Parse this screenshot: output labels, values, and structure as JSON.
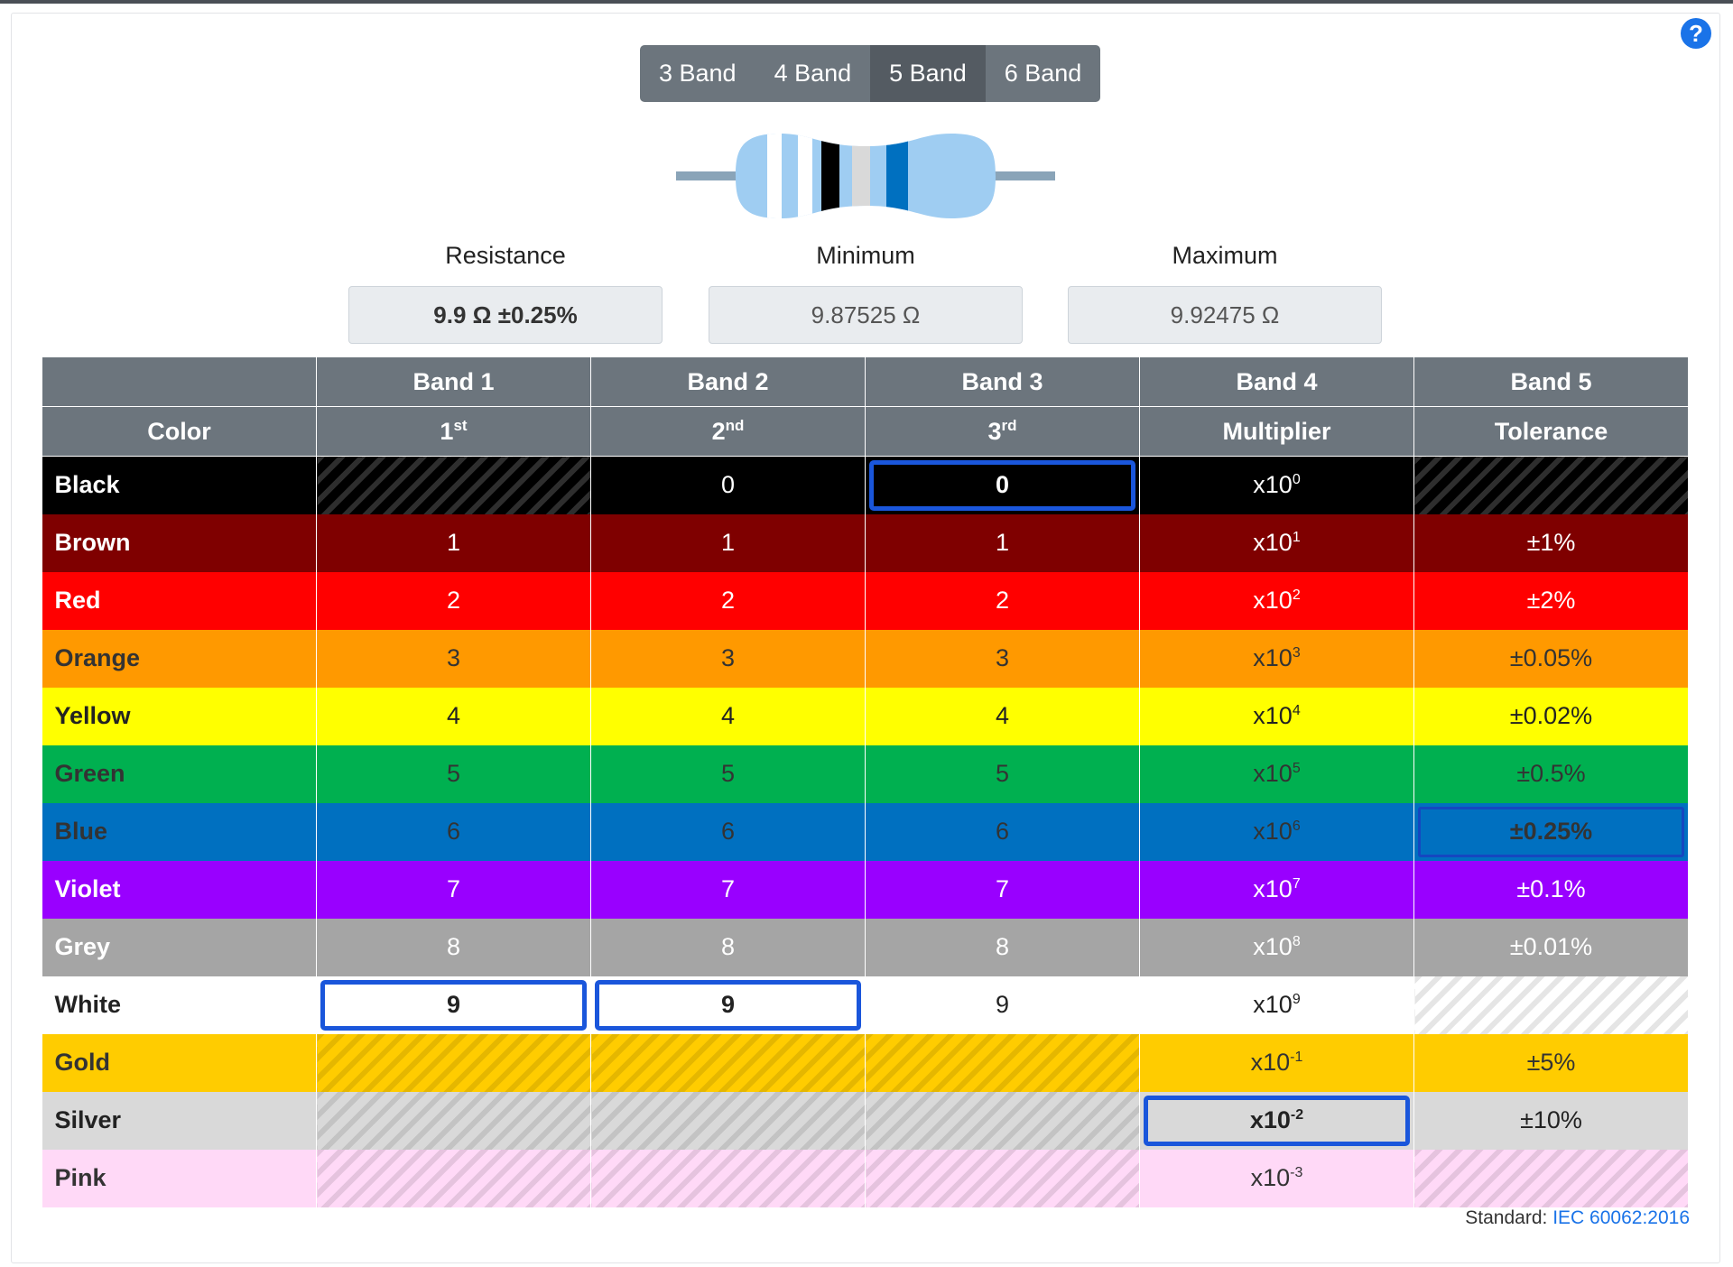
{
  "band_modes": [
    {
      "label": "3 Band",
      "active": false
    },
    {
      "label": "4 Band",
      "active": false
    },
    {
      "label": "5 Band",
      "active": true
    },
    {
      "label": "6 Band",
      "active": false
    }
  ],
  "help_icon": "question-circle-icon",
  "resistor_bands": [
    "#ffffff",
    "#ffffff",
    "#000000",
    "#d9d9d9",
    "#0070c0"
  ],
  "readouts": {
    "resistance_label": "Resistance",
    "resistance_value": "9.9 Ω ±0.25%",
    "minimum_label": "Minimum",
    "minimum_value": "9.87525 Ω",
    "maximum_label": "Maximum",
    "maximum_value": "9.92475 Ω"
  },
  "table": {
    "header_row1": [
      "",
      "Band 1",
      "Band 2",
      "Band 3",
      "Band 4",
      "Band 5"
    ],
    "header_row2": [
      {
        "text": "Color",
        "sup": ""
      },
      {
        "text": "1",
        "sup": "st"
      },
      {
        "text": "2",
        "sup": "nd"
      },
      {
        "text": "3",
        "sup": "rd"
      },
      {
        "text": "Multiplier",
        "sup": ""
      },
      {
        "text": "Tolerance",
        "sup": ""
      }
    ],
    "rows": [
      {
        "name": "Black",
        "bg": "#000000",
        "fg": "#ffffff",
        "d1": "",
        "d2": "0",
        "d3": "0",
        "mult": "0",
        "tol": ""
      },
      {
        "name": "Brown",
        "bg": "#7f0000",
        "fg": "#ffffff",
        "d1": "1",
        "d2": "1",
        "d3": "1",
        "mult": "1",
        "tol": "±1%"
      },
      {
        "name": "Red",
        "bg": "#ff0000",
        "fg": "#ffffff",
        "d1": "2",
        "d2": "2",
        "d3": "2",
        "mult": "2",
        "tol": "±2%"
      },
      {
        "name": "Orange",
        "bg": "#ff9900",
        "fg": "#333333",
        "d1": "3",
        "d2": "3",
        "d3": "3",
        "mult": "3",
        "tol": "±0.05%"
      },
      {
        "name": "Yellow",
        "bg": "#ffff00",
        "fg": "#222222",
        "d1": "4",
        "d2": "4",
        "d3": "4",
        "mult": "4",
        "tol": "±0.02%"
      },
      {
        "name": "Green",
        "bg": "#00b050",
        "fg": "#333333",
        "d1": "5",
        "d2": "5",
        "d3": "5",
        "mult": "5",
        "tol": "±0.5%"
      },
      {
        "name": "Blue",
        "bg": "#0070c0",
        "fg": "#333333",
        "d1": "6",
        "d2": "6",
        "d3": "6",
        "mult": "6",
        "tol": "±0.25%"
      },
      {
        "name": "Violet",
        "bg": "#9900ff",
        "fg": "#ffffff",
        "d1": "7",
        "d2": "7",
        "d3": "7",
        "mult": "7",
        "tol": "±0.1%"
      },
      {
        "name": "Grey",
        "bg": "#a5a5a5",
        "fg": "#ffffff",
        "d1": "8",
        "d2": "8",
        "d3": "8",
        "mult": "8",
        "tol": "±0.01%"
      },
      {
        "name": "White",
        "bg": "#ffffff",
        "fg": "#222222",
        "d1": "9",
        "d2": "9",
        "d3": "9",
        "mult": "9",
        "tol": ""
      },
      {
        "name": "Gold",
        "bg": "#ffcc00",
        "fg": "#333333",
        "d1": "",
        "d2": "",
        "d3": "",
        "mult": "-1",
        "tol": "±5%"
      },
      {
        "name": "Silver",
        "bg": "#d9d9d9",
        "fg": "#222222",
        "d1": "",
        "d2": "",
        "d3": "",
        "mult": "-2",
        "tol": "±10%"
      },
      {
        "name": "Pink",
        "bg": "#ffd9f7",
        "fg": "#333333",
        "d1": "",
        "d2": "",
        "d3": "",
        "mult": "-3",
        "tol": ""
      }
    ],
    "multiplier_prefix": "x10",
    "selected": {
      "d1": "White",
      "d2": "White",
      "d3": "Black",
      "mult": "Silver",
      "tol": "Blue"
    }
  },
  "footer": {
    "standard_label": "Standard:",
    "standard_link": "IEC 60062:2016"
  }
}
